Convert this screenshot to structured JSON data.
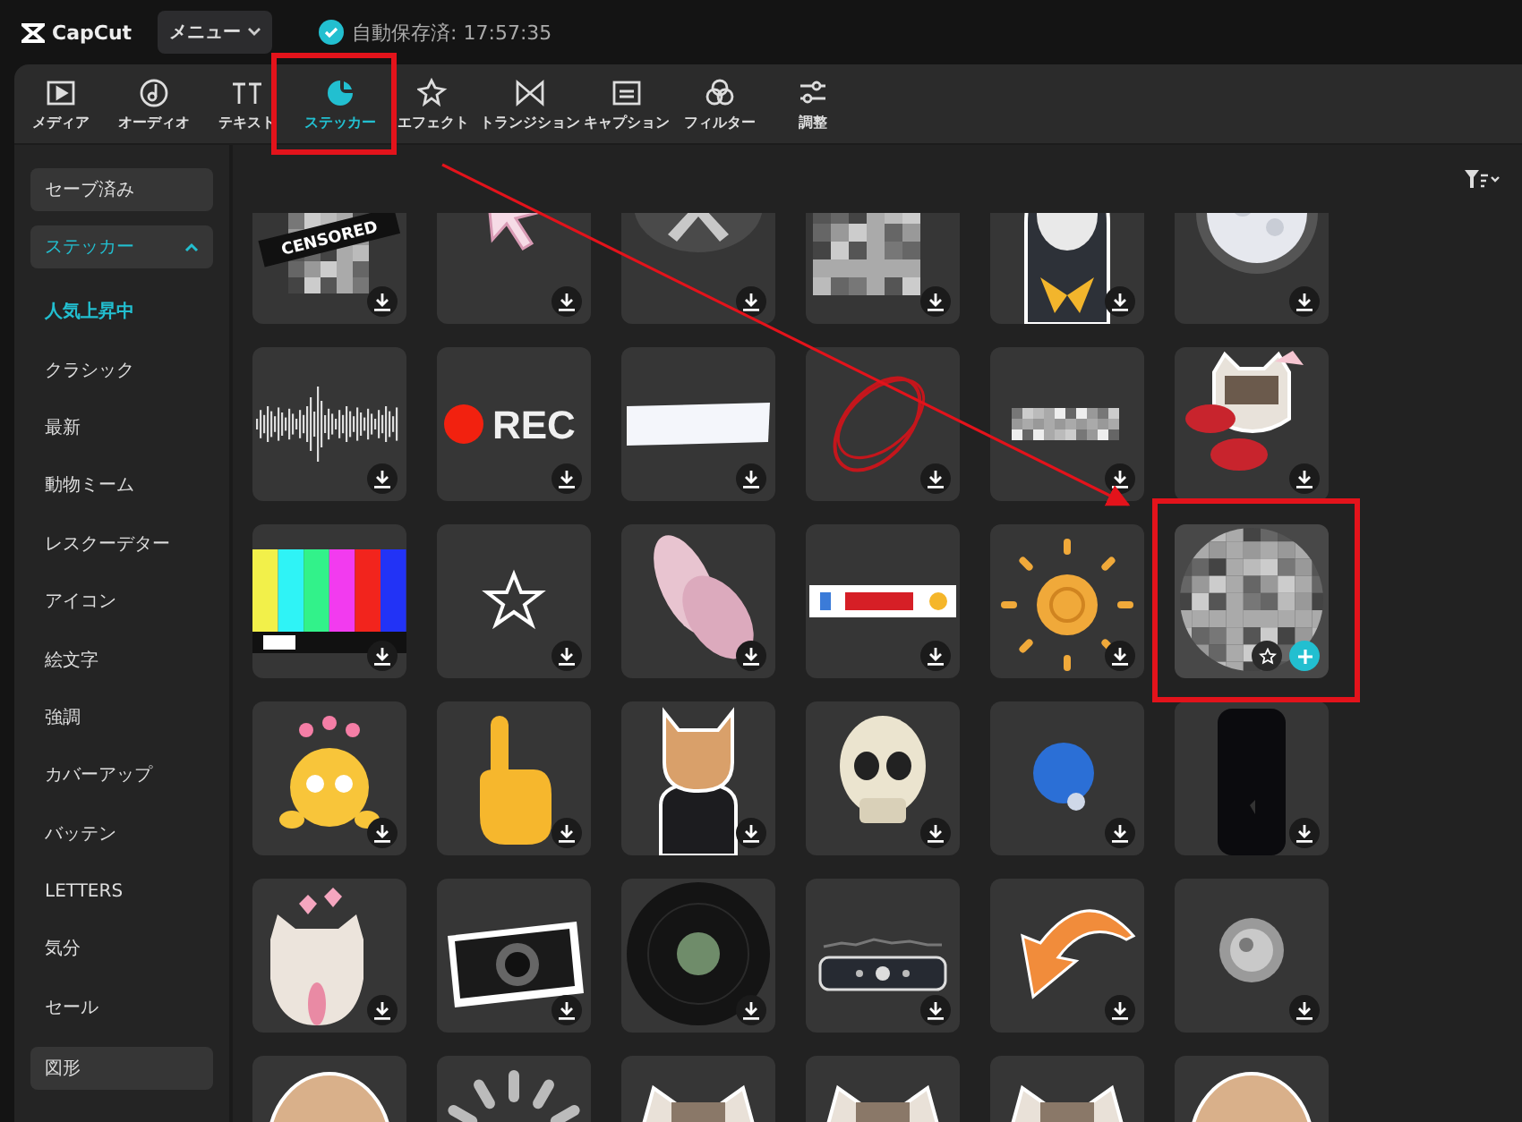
{
  "topbar": {
    "logo": "CapCut",
    "menu": "メニュー",
    "autosave": "自動保存済: 17:57:35"
  },
  "tabs": [
    {
      "label": "メディア",
      "selected": false
    },
    {
      "label": "オーディオ",
      "selected": false
    },
    {
      "label": "テキスト",
      "selected": false
    },
    {
      "label": "ステッカー",
      "selected": true
    },
    {
      "label": "エフェクト",
      "selected": false
    },
    {
      "label": "トランジション",
      "selected": false
    },
    {
      "label": "キャプション",
      "selected": false
    },
    {
      "label": "フィルター",
      "selected": false
    },
    {
      "label": "調整",
      "selected": false
    }
  ],
  "sidebar": {
    "items": [
      {
        "label": "セーブ済み"
      },
      {
        "label": "ステッカー",
        "expanded": true,
        "children": [
          {
            "label": "人気上昇中",
            "selected": true
          },
          {
            "label": "クラシック",
            "selected": false
          },
          {
            "label": "最新",
            "selected": false
          },
          {
            "label": "動物ミーム",
            "selected": false
          },
          {
            "label": "レスクーデター",
            "selected": false
          },
          {
            "label": "アイコン",
            "selected": false
          },
          {
            "label": "絵文字",
            "selected": false
          },
          {
            "label": "強調",
            "selected": false
          },
          {
            "label": "カバーアップ",
            "selected": false
          },
          {
            "label": "バッテン",
            "selected": false
          },
          {
            "label": "LETTERS",
            "selected": false
          },
          {
            "label": "気分",
            "selected": false
          },
          {
            "label": "セール",
            "selected": false
          }
        ]
      },
      {
        "label": "図形"
      }
    ]
  },
  "stickers": [
    {
      "kind": "censored",
      "text": "CENSORED",
      "selected": false
    },
    {
      "kind": "cursor",
      "selected": false
    },
    {
      "kind": "bow",
      "selected": false
    },
    {
      "kind": "mosaic",
      "selected": false
    },
    {
      "kind": "hamster",
      "selected": false
    },
    {
      "kind": "moon",
      "selected": false
    },
    {
      "kind": "waveform",
      "selected": false
    },
    {
      "kind": "rec",
      "text": "REC",
      "selected": false
    },
    {
      "kind": "brushstroke",
      "selected": false
    },
    {
      "kind": "scribble",
      "selected": false
    },
    {
      "kind": "pixelband",
      "selected": false
    },
    {
      "kind": "catkiss",
      "selected": false
    },
    {
      "kind": "colorbars",
      "selected": false
    },
    {
      "kind": "star",
      "selected": false
    },
    {
      "kind": "butterfly",
      "selected": false
    },
    {
      "kind": "subscribe",
      "selected": false
    },
    {
      "kind": "sun",
      "selected": false
    },
    {
      "kind": "mosaicball",
      "selected": true
    },
    {
      "kind": "emoji",
      "selected": false
    },
    {
      "kind": "finger",
      "selected": false
    },
    {
      "kind": "catsuit",
      "selected": false
    },
    {
      "kind": "skull",
      "selected": false
    },
    {
      "kind": "blueface",
      "selected": false
    },
    {
      "kind": "phone",
      "selected": false
    },
    {
      "kind": "cathearts",
      "selected": false
    },
    {
      "kind": "camera",
      "selected": false
    },
    {
      "kind": "vinyl",
      "selected": false
    },
    {
      "kind": "player",
      "selected": false
    },
    {
      "kind": "arrow",
      "selected": false
    },
    {
      "kind": "blob",
      "selected": false
    },
    {
      "kind": "dog",
      "selected": false
    },
    {
      "kind": "spinner",
      "selected": false
    },
    {
      "kind": "cat",
      "selected": false
    },
    {
      "kind": "cat",
      "selected": false
    },
    {
      "kind": "cat",
      "selected": false
    },
    {
      "kind": "dog",
      "selected": false
    }
  ]
}
